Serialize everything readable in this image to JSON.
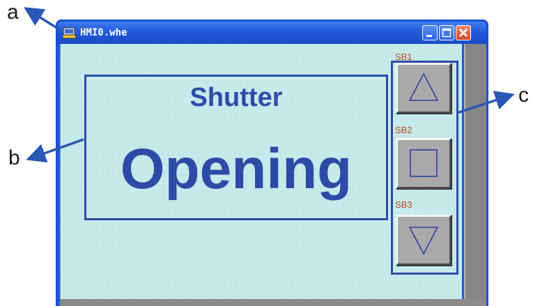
{
  "callouts": {
    "a": "a",
    "b": "b",
    "c": "c"
  },
  "window": {
    "title": "HMI0.whe",
    "app_icon": "hmi-app-icon",
    "controls": {
      "minimize_icon": "minimize-icon",
      "maximize_icon": "maximize-icon",
      "close_icon": "close-icon"
    },
    "title_bar_color": "#1f55d8"
  },
  "status_panel": {
    "heading": "Shutter",
    "state": "Opening",
    "text_color": "#2d4ba6"
  },
  "buttons": [
    {
      "label": "SB1",
      "icon": "triangle-up-icon"
    },
    {
      "label": "SB2",
      "icon": "square-stop-icon"
    },
    {
      "label": "SB3",
      "icon": "triangle-down-icon"
    }
  ],
  "colors": {
    "background": "#c6eaea",
    "frame": "#2d4ba6",
    "label": "#c04c1f",
    "button_face": "#a9a9a9"
  }
}
